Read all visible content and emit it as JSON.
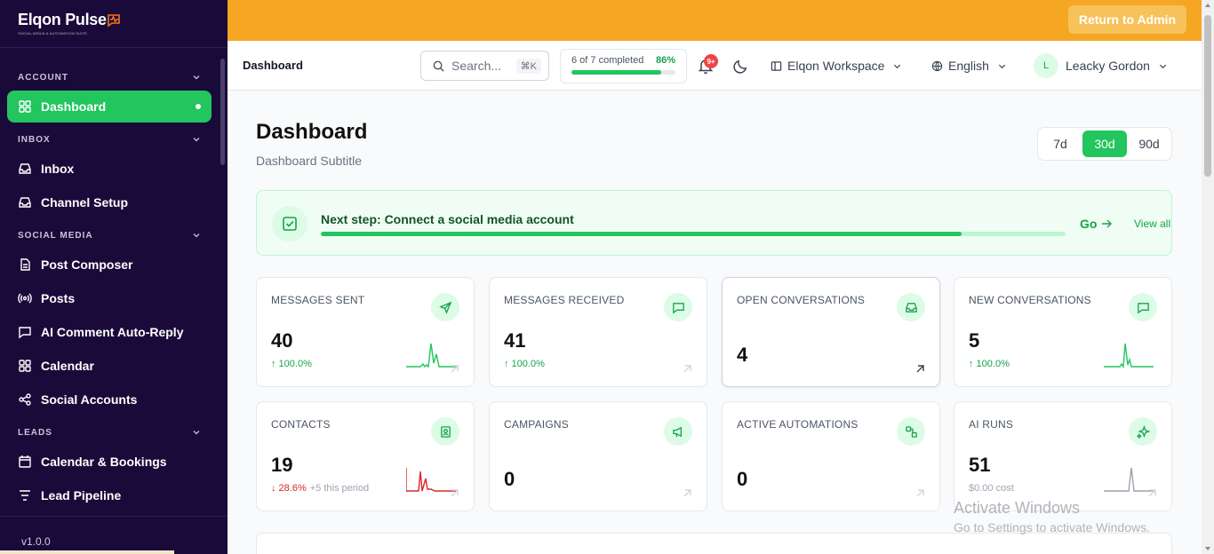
{
  "app": {
    "logo_text": "Elqon Pulse",
    "logo_tagline": "SOCIAL MEDIA & AUTOMATION SUITE",
    "version": "v1.0.0"
  },
  "sidebar": {
    "sections": [
      {
        "title": "ACCOUNT",
        "items": [
          {
            "label": "Dashboard",
            "icon": "grid-icon",
            "active": true
          }
        ]
      },
      {
        "title": "INBOX",
        "items": [
          {
            "label": "Inbox",
            "icon": "inbox-icon"
          },
          {
            "label": "Channel Setup",
            "icon": "inbox-icon"
          }
        ]
      },
      {
        "title": "SOCIAL MEDIA",
        "items": [
          {
            "label": "Post Composer",
            "icon": "document-icon"
          },
          {
            "label": "Posts",
            "icon": "broadcast-icon"
          },
          {
            "label": "AI Comment Auto-Reply",
            "icon": "chat-icon"
          },
          {
            "label": "Calendar",
            "icon": "grid-icon"
          },
          {
            "label": "Social Accounts",
            "icon": "share-icon"
          }
        ]
      },
      {
        "title": "LEADS",
        "items": [
          {
            "label": "Calendar & Bookings",
            "icon": "calendar-icon"
          },
          {
            "label": "Lead Pipeline",
            "icon": "pipeline-icon"
          }
        ]
      }
    ]
  },
  "banner": {
    "return_label": "Return to Admin"
  },
  "header": {
    "title": "Dashboard",
    "search_placeholder": "Search...",
    "search_shortcut": "⌘K",
    "progress_label": "6 of 7 completed",
    "progress_pct_label": "86%",
    "progress_value": 0.86,
    "notif_badge": "9+",
    "workspace": "Elqon Workspace",
    "language": "English",
    "user_initial": "L",
    "user_name": "Leacky Gordon"
  },
  "page": {
    "title": "Dashboard",
    "subtitle": "Dashboard Subtitle",
    "ranges": [
      "7d",
      "30d",
      "90d"
    ],
    "selected_range": "30d"
  },
  "next_step": {
    "title": "Next step: Connect a social media account",
    "progress_value": 0.86,
    "go_label": "Go",
    "view_all_label": "View all"
  },
  "stats": [
    {
      "label": "MESSAGES SENT",
      "value": "40",
      "change": "↑ 100.0%",
      "icon": "send-icon",
      "spark": "green"
    },
    {
      "label": "MESSAGES RECEIVED",
      "value": "41",
      "change": "↑ 100.0%",
      "icon": "message-icon",
      "spark": "none"
    },
    {
      "label": "OPEN CONVERSATIONS",
      "value": "4",
      "change": "",
      "icon": "inbox-icon",
      "spark": "none"
    },
    {
      "label": "NEW CONVERSATIONS",
      "value": "5",
      "change": "↑ 100.0%",
      "icon": "message-icon",
      "spark": "green"
    },
    {
      "label": "CONTACTS",
      "value": "19",
      "change": "↓ 28.6%",
      "extra": "+5 this period",
      "icon": "contact-icon",
      "spark": "red"
    },
    {
      "label": "CAMPAIGNS",
      "value": "0",
      "change": "",
      "icon": "megaphone-icon",
      "spark": "none"
    },
    {
      "label": "ACTIVE AUTOMATIONS",
      "value": "0",
      "change": "",
      "icon": "workflow-icon",
      "spark": "none"
    },
    {
      "label": "AI RUNS",
      "value": "51",
      "cost": "$0.00 cost",
      "icon": "sparkle-icon",
      "spark": "gray"
    }
  ],
  "colors": {
    "sidebar_bg": "#1a0a3a",
    "accent_green": "#22c55e",
    "banner_orange": "#f5a623",
    "down_red": "#dc2626"
  },
  "watermark": {
    "line1": "Activate Windows",
    "line2": "Go to Settings to activate Windows."
  }
}
